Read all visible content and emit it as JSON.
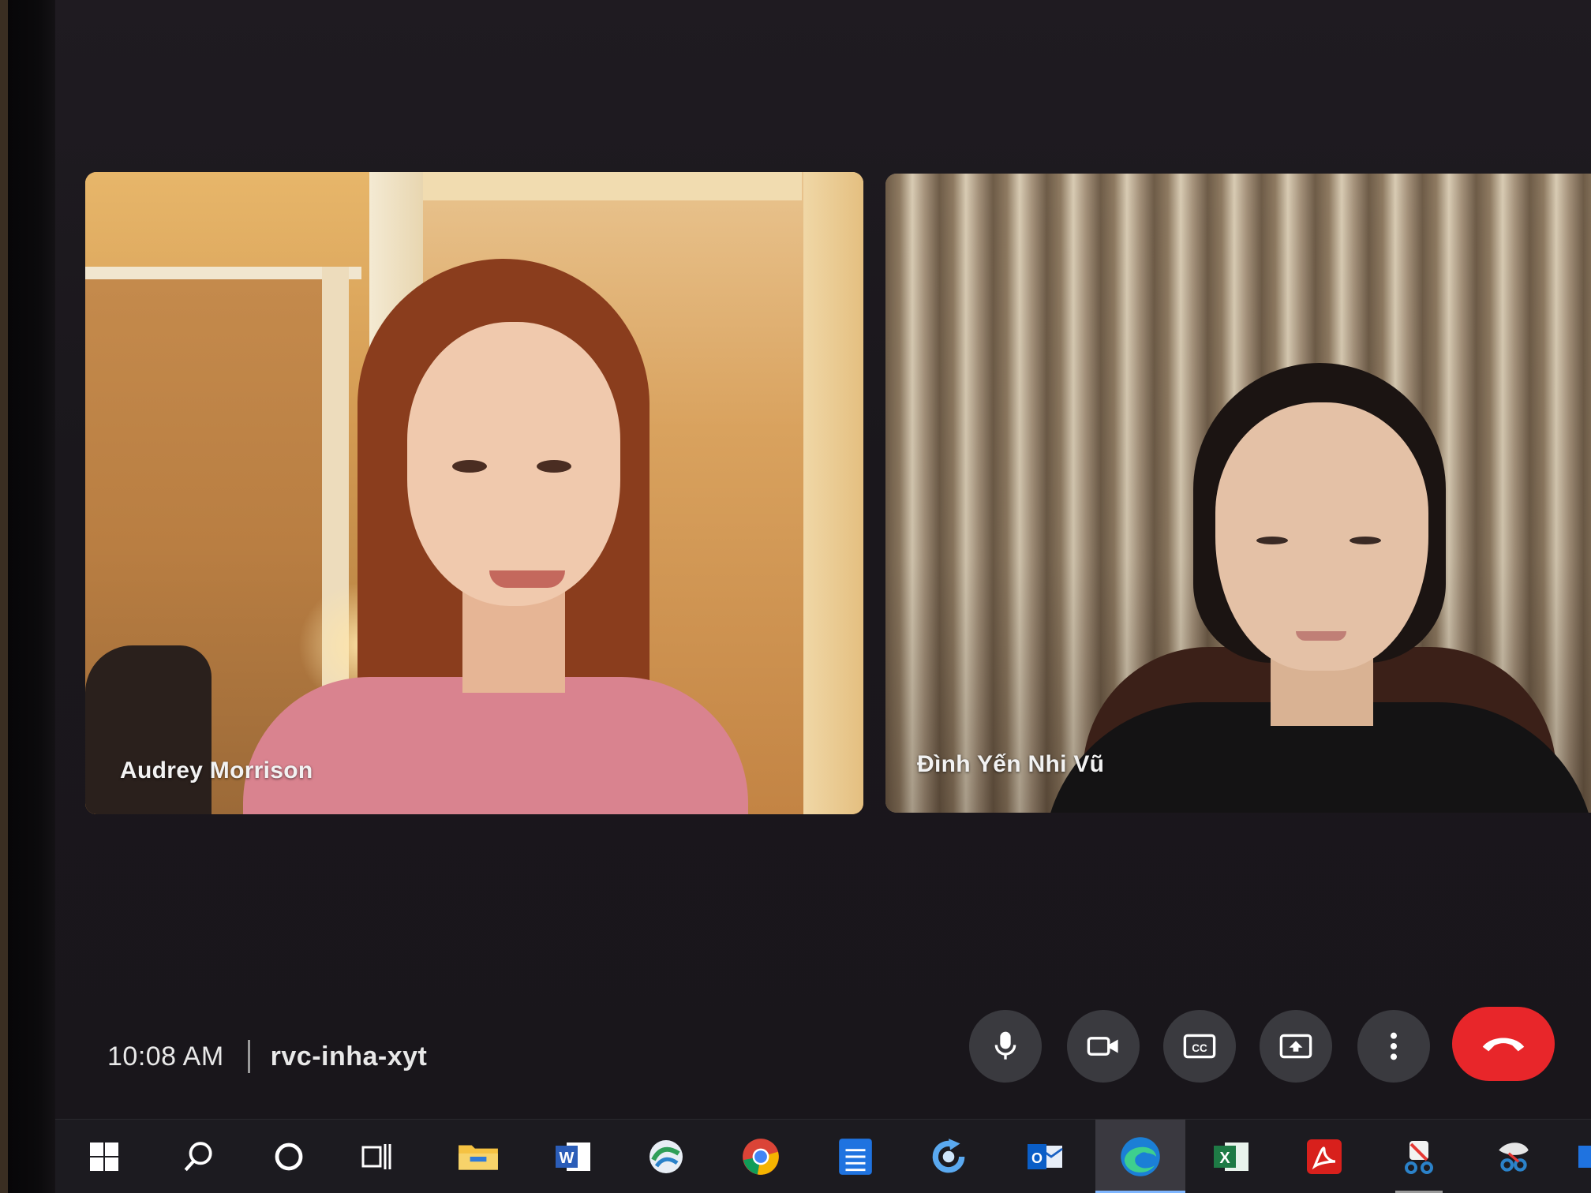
{
  "participants": [
    {
      "name": "Audrey Morrison"
    },
    {
      "name": "Đình Yến Nhi Vũ"
    }
  ],
  "meeting": {
    "time": "10:08 AM",
    "code": "rvc-inha-xyt"
  },
  "controls": {
    "microphone": "mic-icon",
    "camera": "camera-icon",
    "captions": "closed-captions-icon",
    "present": "present-screen-icon",
    "more": "more-vertical-icon",
    "leave": "hang-up-icon"
  },
  "colors": {
    "leave_button": "#e8262a",
    "control_button": "#3a3a3f",
    "background": "#1c191e"
  },
  "taskbar": {
    "apps": [
      "windows-start",
      "search",
      "cortana",
      "task-view",
      "file-explorer",
      "word",
      "connect-app",
      "chrome",
      "document-app",
      "refresh-app",
      "outlook",
      "edge",
      "excel",
      "acrobat",
      "snip-sketch",
      "sketch-app"
    ]
  }
}
